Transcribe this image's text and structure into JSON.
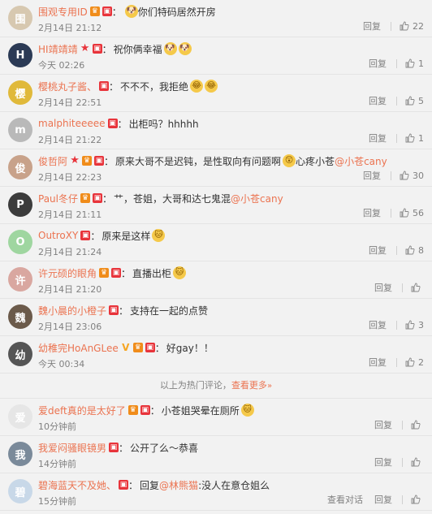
{
  "hot_comments": [
    {
      "user": "围观专用ID",
      "badges": [
        "vip",
        "red"
      ],
      "text": "你们特码居然开房",
      "emoji_before": "doge",
      "time": "2月14日 21:12",
      "reply": "回复",
      "likes": "22",
      "avatar_color": "#d7c8b0",
      "avatar_letter": "围"
    },
    {
      "user": "HI靖靖靖",
      "badges": [
        "star",
        "red"
      ],
      "text": "祝你俩幸福",
      "emoji_after": [
        "doge",
        "doge"
      ],
      "time": "今天 02:26",
      "reply": "回复",
      "likes": "1",
      "avatar_color": "#2b3a55",
      "avatar_letter": "H"
    },
    {
      "user": "樱桃丸子酱、",
      "badges": [
        "red"
      ],
      "text": "不不不，我拒绝",
      "emoji_after": [
        "lol",
        "lol"
      ],
      "time": "2月14日 22:51",
      "reply": "回复",
      "likes": "5",
      "avatar_color": "#e0b93a",
      "avatar_letter": "樱"
    },
    {
      "user": "malphiteeeee",
      "badges": [
        "red"
      ],
      "text": "出柜吗？hhhhh",
      "time": "2月14日 21:22",
      "reply": "回复",
      "likes": "1",
      "avatar_color": "#b9b9b9",
      "avatar_letter": "m"
    },
    {
      "user": "俊哲阿",
      "badges": [
        "star",
        "vip",
        "red"
      ],
      "text": "原来大哥不是迟钝，是性取向有问题啊",
      "emoji_after": [
        "wow"
      ],
      "text2": "心疼小苍",
      "mention": "@小苍cany",
      "time": "2月14日 22:23",
      "reply": "回复",
      "likes": "30",
      "avatar_color": "#c8a28a",
      "avatar_letter": "俊"
    },
    {
      "user": "Paul冬仔",
      "badges": [
        "vip",
        "red"
      ],
      "text": "艹，苍姐，大哥和达七鬼混",
      "mention": "@小苍cany",
      "time": "2月14日 21:11",
      "reply": "回复",
      "likes": "56",
      "avatar_color": "#3c3c3c",
      "avatar_letter": "P"
    },
    {
      "user": "OutroXY",
      "badges": [
        "red"
      ],
      "text": "原来是这样",
      "emoji_after": [
        "cat"
      ],
      "time": "2月14日 21:24",
      "reply": "回复",
      "likes": "8",
      "avatar_color": "#9fd6a0",
      "avatar_letter": "O"
    },
    {
      "user": "许元硕的眼角",
      "badges": [
        "vip",
        "red"
      ],
      "text": "直播出柜",
      "emoji_after": [
        "cat"
      ],
      "time": "2月14日 21:20",
      "reply": "回复",
      "likes": "",
      "avatar_color": "#d9a7a0",
      "avatar_letter": "许"
    },
    {
      "user": "魏小晨的小橙子",
      "badges": [
        "red"
      ],
      "text": "支持在一起的点赞",
      "time": "2月14日 23:06",
      "reply": "回复",
      "likes": "3",
      "avatar_color": "#6b5a4a",
      "avatar_letter": "魏"
    },
    {
      "user": "幼稚完HoAnGLee",
      "badges": [
        "v",
        "vip",
        "red"
      ],
      "text": "好gay！！",
      "time": "今天 00:34",
      "reply": "回复",
      "likes": "2",
      "avatar_color": "#555",
      "avatar_letter": "幼"
    }
  ],
  "hotbar": {
    "text": "以上为热门评论，",
    "more": "查看更多",
    "chevron": "»"
  },
  "new_comments": [
    {
      "user": "爱deft真的是太好了",
      "badges": [
        "vip",
        "red"
      ],
      "text": "小苍姐哭晕在厕所",
      "emoji_after": [
        "cat"
      ],
      "time": "10分钟前",
      "reply": "回复",
      "likes": "",
      "avatar_color": "#e6e6e6",
      "avatar_letter": "爱"
    },
    {
      "user": "我爱闷骚眼镜男",
      "badges": [
        "red"
      ],
      "text": "公开了么～恭喜",
      "time": "14分钟前",
      "reply": "回复",
      "likes": "",
      "avatar_color": "#7a8a9a",
      "avatar_letter": "我"
    },
    {
      "user": "碧海蓝天不及她、",
      "badges": [
        "red"
      ],
      "text": "回复",
      "mention": "@林熊猫",
      "text_after_mention": ":没人在意仓姐么",
      "time": "15分钟前",
      "view_conv": "查看对话",
      "reply": "回复",
      "likes": "",
      "avatar_color": "#c8d8e8",
      "avatar_letter": "碧"
    }
  ],
  "colors": {
    "username": "#eb7350",
    "meta": "#808080",
    "background": "#f2f2f2"
  }
}
